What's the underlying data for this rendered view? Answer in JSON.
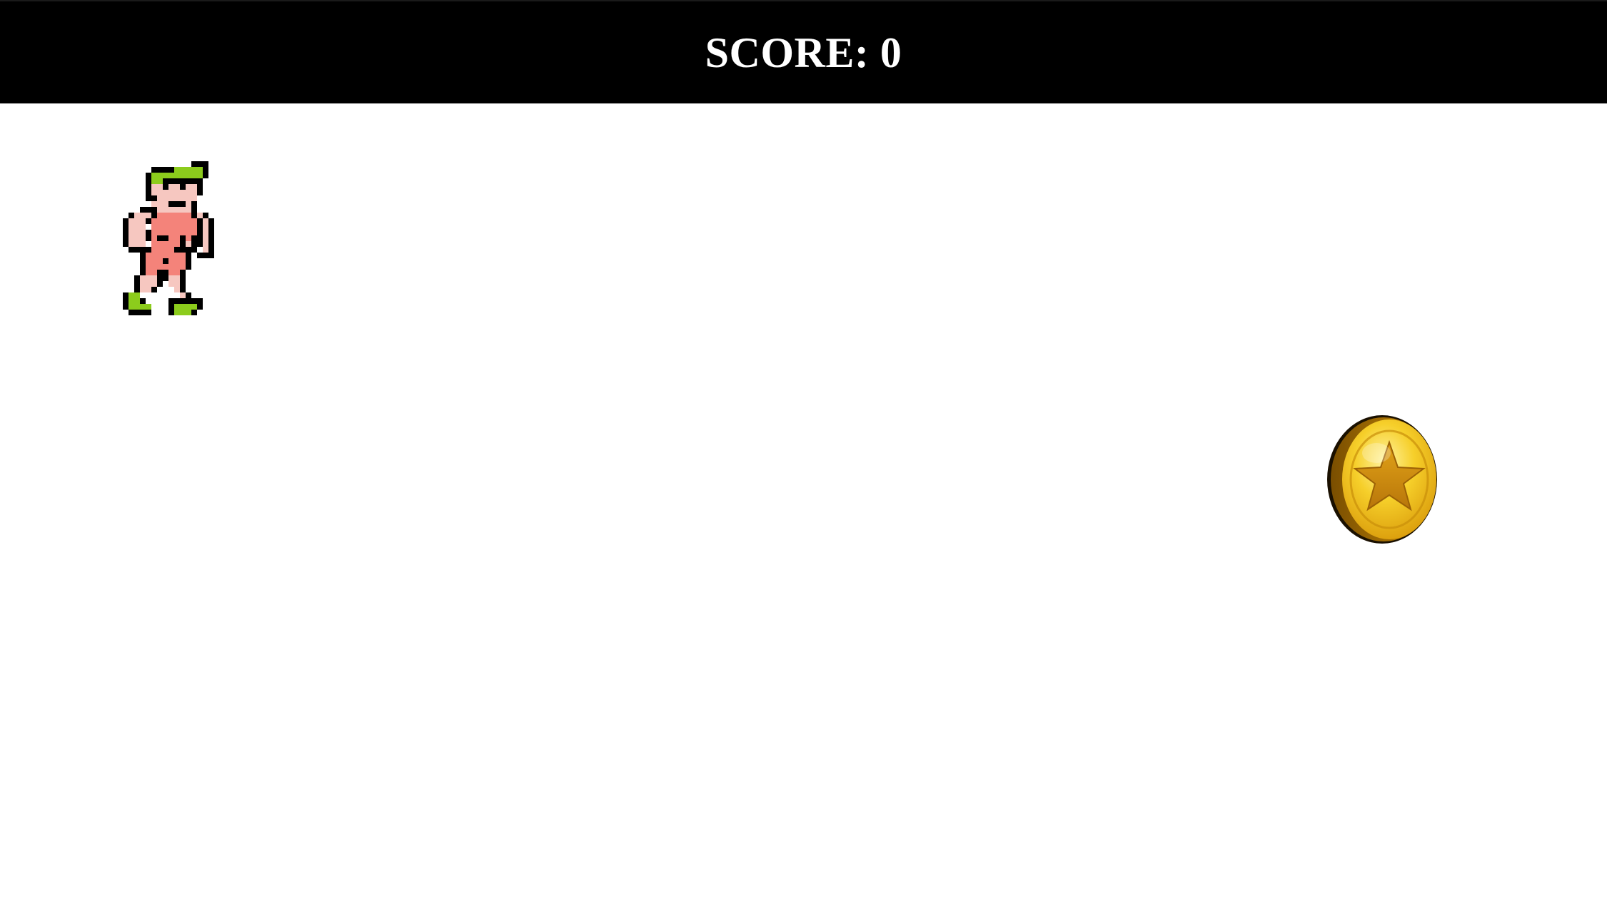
{
  "hud": {
    "score_label": "SCORE:",
    "score_value": "0"
  },
  "sprites": {
    "player": {
      "icon": "player-character-icon"
    },
    "coin": {
      "icon": "star-coin-icon"
    }
  },
  "colors": {
    "hud_background": "#000000",
    "hud_text": "#ffffff",
    "canvas_background": "#ffffff",
    "player_hat": "#8ccc1c",
    "player_skin": "#f6c7c0",
    "player_outfit": "#f4837a",
    "coin_gold": "#f2c21a",
    "coin_edge": "#b17a05"
  }
}
